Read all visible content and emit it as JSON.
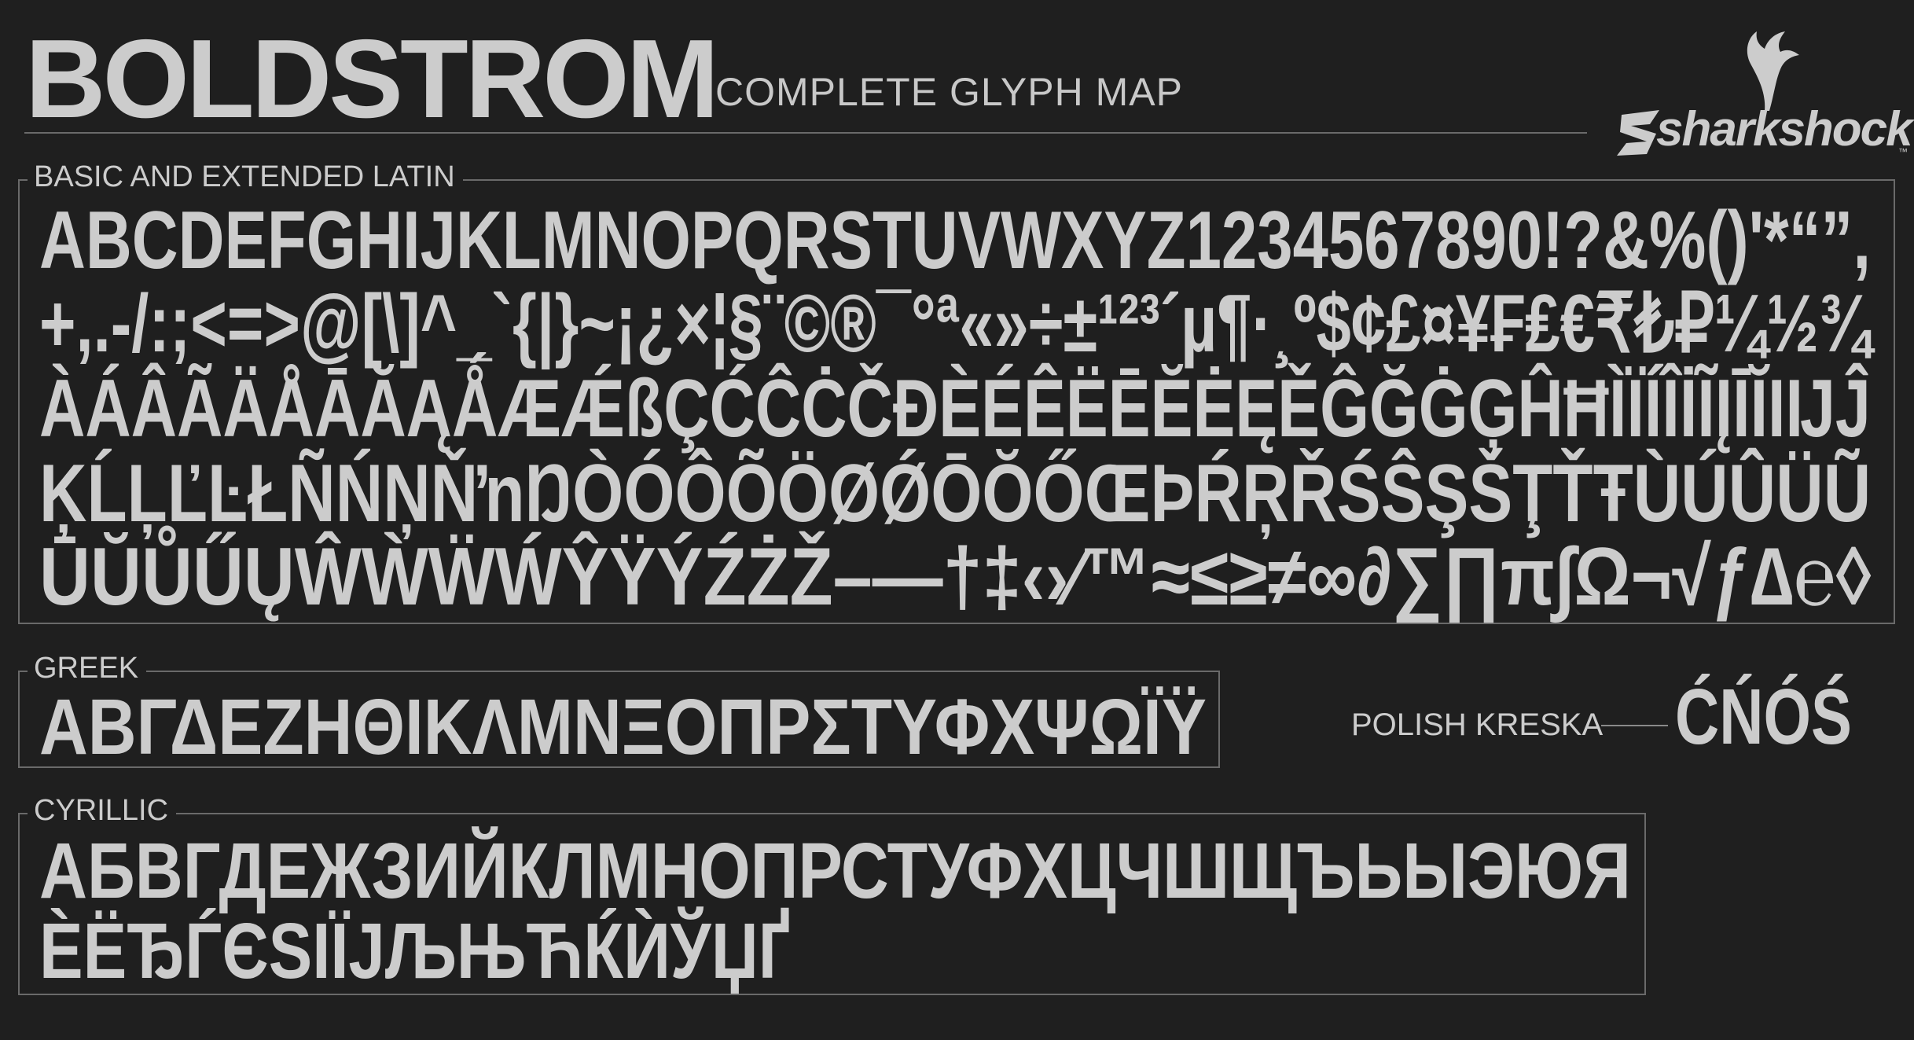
{
  "header": {
    "title": "BOLDSTROM",
    "subtitle": "COMPLETE GLYPH MAP",
    "brand": "sharkshock",
    "brand_tm": "™"
  },
  "latin": {
    "label": "BASIC AND EXTENDED LATIN",
    "rows": [
      "ABCDEFGHIJKLMNOPQRSTUVWXYZ1234567890!?&%()'*“”,",
      "+,.-/:;<=>@[\\]^_`{|}~¡¿×¦§¨©®¯°ª«»÷±¹²³´µ¶·¸º$¢£¤¥₣₤€₹₺₽¼½¾",
      "ÀÁÂÃÄÅĀĂĄǺÆǼßÇĆĈĊČĐÈÉÊËĒĔĖĘĚĜĞĠĢĤĦÌÏÍÎİĨĮĪĬIĲĴ",
      "ĶĹĻĽĿŁÑŃŅŇŉŊÒÓÔÕÖØǾŌŎŐŒÞŔŖŘŚŜŞŠŢŤŦÙÚÛÜŨ",
      "ŪŬŮŰŲŴẀẄẂŶŸÝŹŻŽ–—†‡‹›⁄™≈≤≥≠∞∂∑∏π∫Ω¬√ƒ∆℮◊"
    ]
  },
  "greek": {
    "label": "GREEK",
    "row": "ΑΒΓΔΕΖΗΘΙΚΛΜΝΞΟΠΡΣΤΥΦΧΨΩΪΫ"
  },
  "polish": {
    "label": "POLISH KRESKA",
    "glyphs": "ĆŃÓŚ"
  },
  "cyrillic": {
    "label": "CYRILLIC",
    "rows": [
      "АБВГДЕЖЗИЙКЛМНОПРСТУФХЦЧШЩЪЬЫЭЮЯ",
      "ЀЁЂЃЄЅІЇЈЉЊЋЌЍЎЏҐ"
    ]
  },
  "colors": {
    "background": "#1f1f1f",
    "glyph": "#cccccc",
    "rule": "#6a6a6a"
  }
}
